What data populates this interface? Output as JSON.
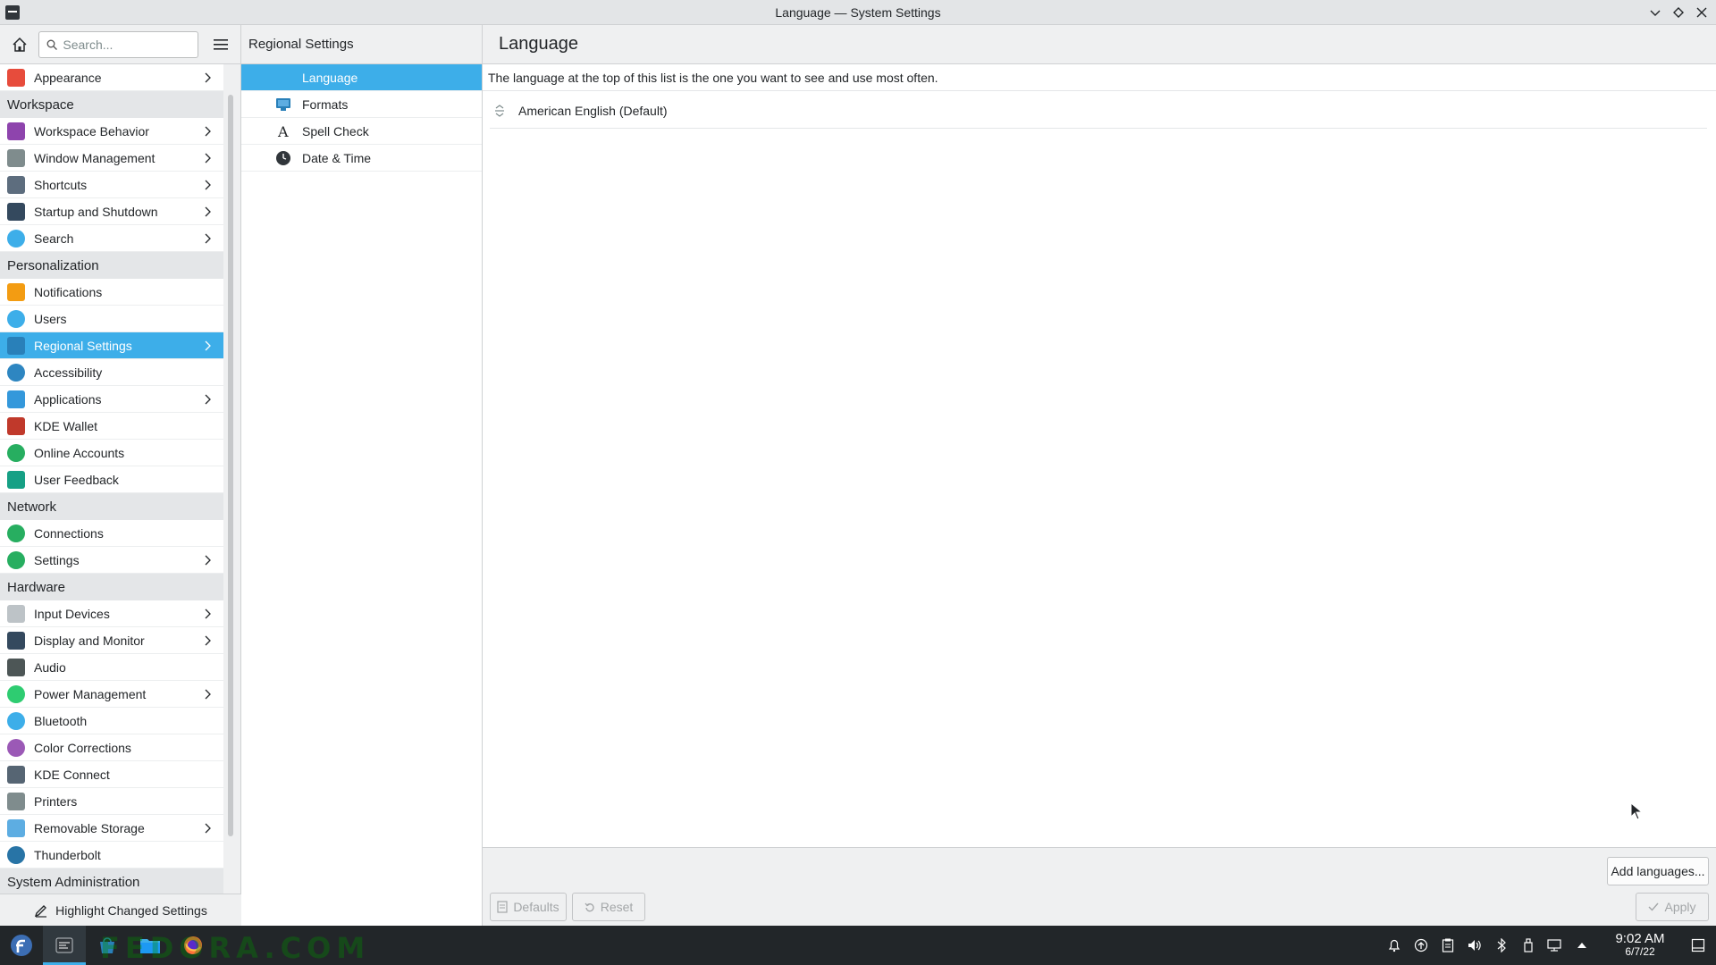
{
  "window": {
    "title": "Language — System Settings",
    "buttons": [
      "minimize",
      "maximize",
      "close"
    ]
  },
  "sidebar": {
    "search_placeholder": "Search...",
    "items": [
      {
        "type": "item",
        "label": "Appearance",
        "icon": "appearance-icon",
        "color": "#e74c3c",
        "chevron": true
      },
      {
        "type": "section",
        "label": "Workspace"
      },
      {
        "type": "item",
        "label": "Workspace Behavior",
        "icon": "workspace-behavior-icon",
        "color": "#8e44ad",
        "chevron": true
      },
      {
        "type": "item",
        "label": "Window Management",
        "icon": "window-management-icon",
        "color": "#7f8c8d",
        "chevron": true
      },
      {
        "type": "item",
        "label": "Shortcuts",
        "icon": "keyboard-icon",
        "color": "#5d6d7e",
        "chevron": true
      },
      {
        "type": "item",
        "label": "Startup and Shutdown",
        "icon": "startup-icon",
        "color": "#34495e",
        "chevron": true
      },
      {
        "type": "item",
        "label": "Search",
        "icon": "search-icon",
        "color": "#3daee9",
        "chevron": true
      },
      {
        "type": "section",
        "label": "Personalization"
      },
      {
        "type": "item",
        "label": "Notifications",
        "icon": "bell-icon",
        "color": "#f39c12",
        "chevron": false
      },
      {
        "type": "item",
        "label": "Users",
        "icon": "users-icon",
        "color": "#3daee9",
        "chevron": false
      },
      {
        "type": "item",
        "label": "Regional Settings",
        "icon": "regional-icon",
        "color": "#2980b9",
        "chevron": true,
        "active": true
      },
      {
        "type": "item",
        "label": "Accessibility",
        "icon": "accessibility-icon",
        "color": "#2e86c1",
        "chevron": false
      },
      {
        "type": "item",
        "label": "Applications",
        "icon": "applications-icon",
        "color": "#3498db",
        "chevron": true
      },
      {
        "type": "item",
        "label": "KDE Wallet",
        "icon": "wallet-icon",
        "color": "#c0392b",
        "chevron": false
      },
      {
        "type": "item",
        "label": "Online Accounts",
        "icon": "globe-icon",
        "color": "#27ae60",
        "chevron": false
      },
      {
        "type": "item",
        "label": "User Feedback",
        "icon": "feedback-icon",
        "color": "#16a085",
        "chevron": false
      },
      {
        "type": "section",
        "label": "Network"
      },
      {
        "type": "item",
        "label": "Connections",
        "icon": "connections-icon",
        "color": "#27ae60",
        "chevron": false
      },
      {
        "type": "item",
        "label": "Settings",
        "icon": "network-settings-icon",
        "color": "#27ae60",
        "chevron": true
      },
      {
        "type": "section",
        "label": "Hardware"
      },
      {
        "type": "item",
        "label": "Input Devices",
        "icon": "mouse-icon",
        "color": "#bdc3c7",
        "chevron": true
      },
      {
        "type": "item",
        "label": "Display and Monitor",
        "icon": "monitor-icon",
        "color": "#34495e",
        "chevron": true
      },
      {
        "type": "item",
        "label": "Audio",
        "icon": "audio-icon",
        "color": "#4d5656",
        "chevron": false
      },
      {
        "type": "item",
        "label": "Power Management",
        "icon": "power-icon",
        "color": "#2ecc71",
        "chevron": true
      },
      {
        "type": "item",
        "label": "Bluetooth",
        "icon": "bluetooth-icon",
        "color": "#3daee9",
        "chevron": false
      },
      {
        "type": "item",
        "label": "Color Corrections",
        "icon": "color-icon",
        "color": "#9b59b6",
        "chevron": false
      },
      {
        "type": "item",
        "label": "KDE Connect",
        "icon": "phone-icon",
        "color": "#566573",
        "chevron": false
      },
      {
        "type": "item",
        "label": "Printers",
        "icon": "printer-icon",
        "color": "#7f8c8d",
        "chevron": false
      },
      {
        "type": "item",
        "label": "Removable Storage",
        "icon": "storage-icon",
        "color": "#5dade2",
        "chevron": true
      },
      {
        "type": "item",
        "label": "Thunderbolt",
        "icon": "thunderbolt-icon",
        "color": "#2874a6",
        "chevron": false
      },
      {
        "type": "section",
        "label": "System Administration"
      }
    ],
    "highlight_label": "Highlight Changed Settings"
  },
  "middle": {
    "title": "Regional Settings",
    "items": [
      {
        "label": "Language",
        "icon": "language-icon",
        "active": true
      },
      {
        "label": "Formats",
        "icon": "formats-icon",
        "active": false
      },
      {
        "label": "Spell Check",
        "icon": "spellcheck-icon",
        "active": false
      },
      {
        "label": "Date & Time",
        "icon": "clock-icon",
        "active": false
      }
    ]
  },
  "main": {
    "title": "Language",
    "info": "The language at the top of this list is the one you want to see and use most often.",
    "languages": [
      "American English (Default)"
    ],
    "add_label": "Add languages...",
    "defaults_label": "Defaults",
    "reset_label": "Reset",
    "apply_label": "Apply"
  },
  "taskbar": {
    "watermark": "FEDORA.COM",
    "time": "9:02 AM",
    "date": "6/7/22",
    "apps": [
      "kde-menu-icon",
      "system-settings-icon",
      "discover-icon",
      "dolphin-icon",
      "firefox-icon"
    ]
  },
  "colors": {
    "accent": "#3daee9",
    "panel": "#222629",
    "window_bg": "#eff0f1"
  }
}
